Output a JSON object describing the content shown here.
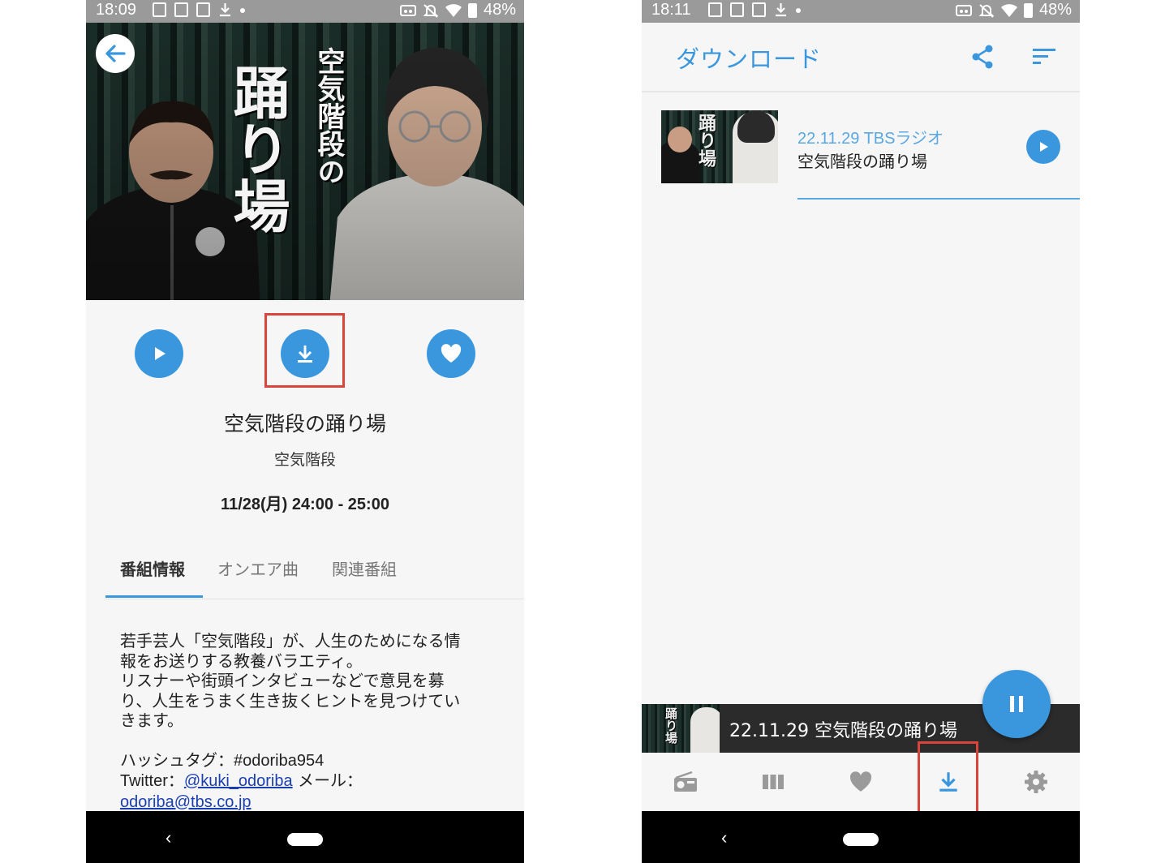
{
  "left": {
    "status": {
      "time": "18:09",
      "battery": "48%"
    },
    "hero": {
      "title_art_line1": "空気階段の",
      "title_art_line2": "踊り場"
    },
    "program": {
      "title": "空気階段の踊り場",
      "cast": "空気階段",
      "time": "11/28(月)  24:00 - 25:00"
    },
    "tabs": [
      {
        "label": "番組情報",
        "active": true
      },
      {
        "label": "オンエア曲",
        "active": false
      },
      {
        "label": "関連番組",
        "active": false
      }
    ],
    "description": {
      "line1": "若手芸人「空気階段」が、人生のためになる情",
      "line2": "報をお送りする教養バラエティ。",
      "line3": "リスナーや街頭インタビューなどで意見を募",
      "line4": "り、人生をうまく生き抜くヒントを見つけてい",
      "line5": "きます。",
      "hashtag_label": "ハッシュタグ：",
      "hashtag": "#odoriba954",
      "twitter_label": "Twitter：",
      "twitter_handle": "@kuki_odoriba",
      "mail_label": " メール：",
      "mail": "odoriba@tbs.co.jp"
    },
    "nav": {
      "back_glyph": "‹"
    }
  },
  "right": {
    "status": {
      "time": "18:11",
      "battery": "48%"
    },
    "header": {
      "title": "ダウンロード"
    },
    "downloads": [
      {
        "date_station": "22.11.29  TBSラジオ",
        "title": "空気階段の踊り場",
        "thumb_text": "踊り場"
      }
    ],
    "player": {
      "now_playing": "22.11.29  空気階段の踊り場",
      "thumb_text": "踊り場"
    },
    "nav": {
      "back_glyph": "‹"
    }
  },
  "colors": {
    "accent": "#3a96dd",
    "highlight": "#d9443b",
    "nav_bg": "#000000",
    "player_bg": "#2b2b2b"
  },
  "icons": [
    "back-arrow-icon",
    "play-icon",
    "download-icon",
    "heart-icon",
    "share-icon",
    "sort-icon",
    "pause-icon",
    "radio-icon",
    "grid-icon",
    "settings-icon"
  ]
}
